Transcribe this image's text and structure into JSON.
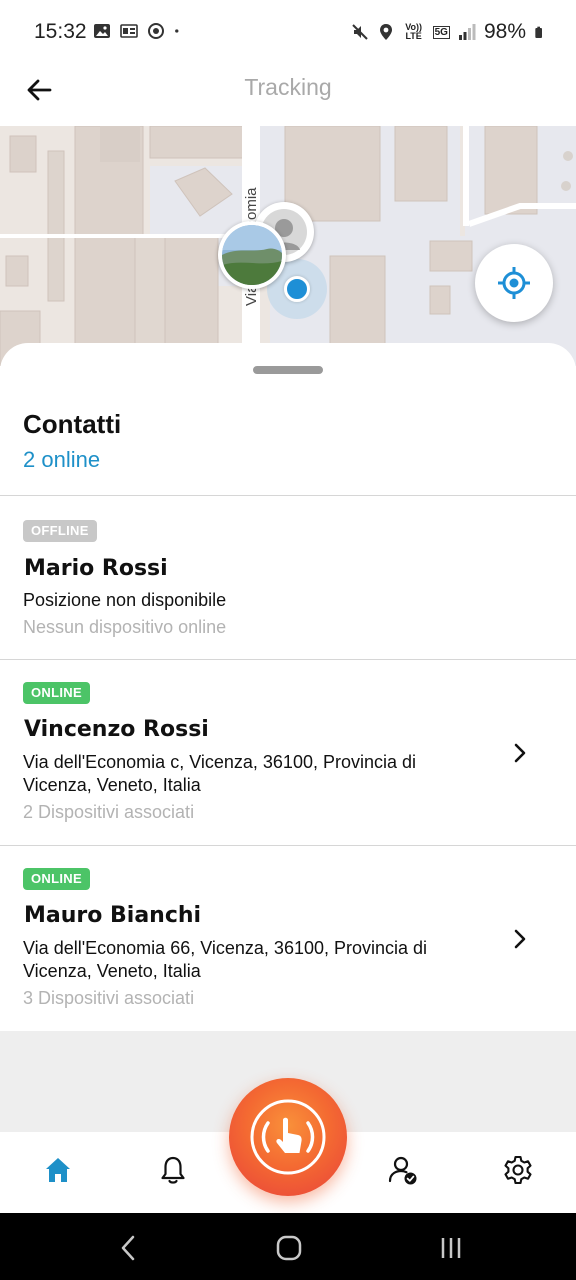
{
  "status_bar": {
    "time": "15:32",
    "battery": "98%",
    "left_icons": [
      "image-icon",
      "nfc-card-icon",
      "activity-ring-icon",
      "dot-icon"
    ],
    "right_icons": [
      "mute-icon",
      "location-pin-icon",
      "volte-icon",
      "5g-icon",
      "signal-icon",
      "battery-icon"
    ],
    "volte_label": "Vo)) LTE",
    "net_label": "5G"
  },
  "app_bar": {
    "title": "Tracking",
    "back_icon": "arrow-left-icon"
  },
  "map": {
    "street_label": "Via dell'Economia",
    "locate_icon": "crosshair-icon",
    "accent": "#1e8fd6"
  },
  "sheet": {
    "title": "Contatti",
    "subtitle": "2 online"
  },
  "contacts": [
    {
      "status": "OFFLINE",
      "name": "Mario Rossi",
      "address": "Posizione non disponibile",
      "devices": "Nessun dispositivo online"
    },
    {
      "status": "ONLINE",
      "name": "Vincenzo Rossi",
      "address": "Via dell'Economia c, Vicenza, 36100, Provincia di Vicenza, Veneto, Italia",
      "devices": "2 Dispositivi associati"
    },
    {
      "status": "ONLINE",
      "name": "Mauro Bianchi",
      "address": "Via dell'Economia 66, Vicenza, 36100, Provincia di Vicenza, Veneto, Italia",
      "devices": "3 Dispositivi associati"
    }
  ],
  "bottom_nav": {
    "items": [
      "home-icon",
      "bell-icon",
      "sos-touch-icon",
      "user-check-icon",
      "gear-icon"
    ],
    "active_color": "#1e90c8"
  },
  "system_nav": [
    "back-chevron-icon",
    "home-circle-icon",
    "recents-icon"
  ]
}
